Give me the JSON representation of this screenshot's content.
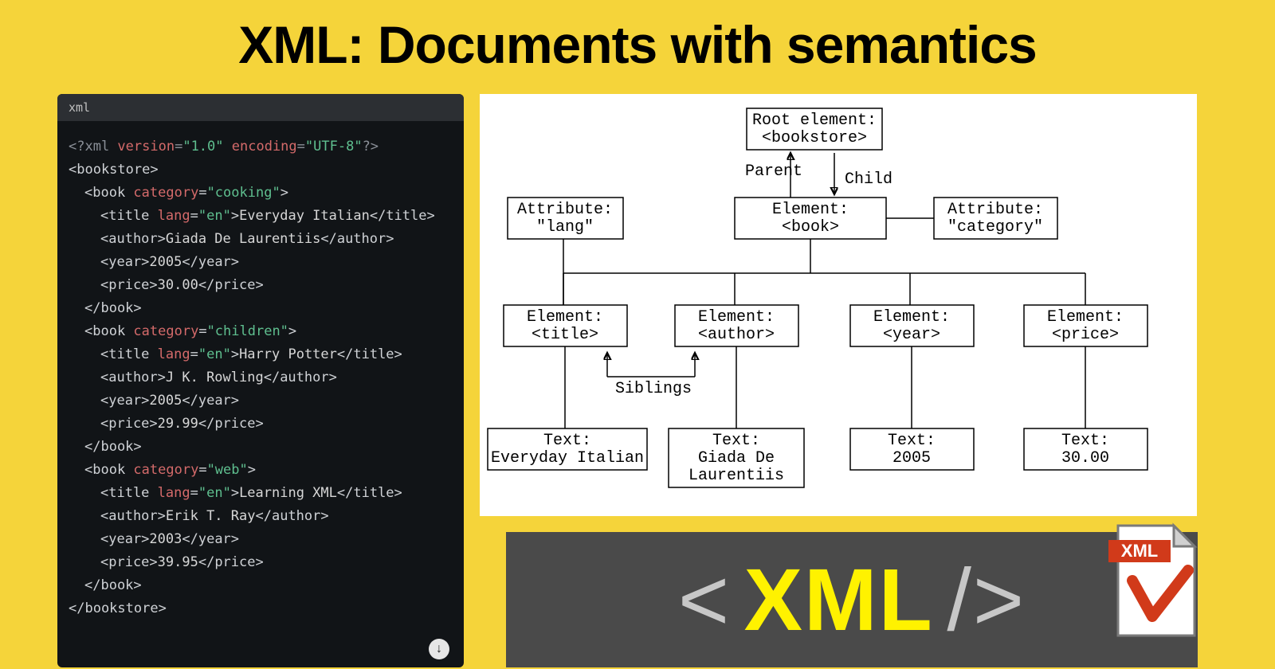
{
  "title": "XML: Documents with semantics",
  "code": {
    "tab": "xml",
    "decl_prefix": "<?xml ",
    "decl_attr1": "version",
    "decl_val1": "\"1.0\"",
    "decl_attr2": "encoding",
    "decl_val2": "\"UTF-8\"",
    "decl_suffix": "?>",
    "root_open": "<bookstore>",
    "root_close": "</bookstore>",
    "book_open_prefix": "<book ",
    "book_attr": "category",
    "book_close_tag": "</book>",
    "title_open_prefix": "<title ",
    "title_attr": "lang",
    "title_attr_val": "\"en\"",
    "title_close": "</title>",
    "author_open": "<author>",
    "author_close": "</author>",
    "year_open": "<year>",
    "year_close": "</year>",
    "price_open": "<price>",
    "price_close": "</price>",
    "books": [
      {
        "category": "\"cooking\"",
        "title": "Everyday Italian",
        "author": "Giada De Laurentiis",
        "year": "2005",
        "price": "30.00"
      },
      {
        "category": "\"children\"",
        "title": "Harry Potter",
        "author": "J K. Rowling",
        "year": "2005",
        "price": "29.99"
      },
      {
        "category": "\"web\"",
        "title": "Learning XML",
        "author": "Erik T. Ray",
        "year": "2003",
        "price": "39.95"
      }
    ]
  },
  "tree": {
    "root_l1": "Root element:",
    "root_l2": "<bookstore>",
    "parent_label": "Parent",
    "child_label": "Child",
    "attr_lang_l1": "Attribute:",
    "attr_lang_l2": "\"lang\"",
    "attr_cat_l1": "Attribute:",
    "attr_cat_l2": "\"category\"",
    "book_l1": "Element:",
    "book_l2": "<book>",
    "title_l1": "Element:",
    "title_l2": "<title>",
    "author_l1": "Element:",
    "author_l2": "<author>",
    "year_l1": "Element:",
    "year_l2": "<year>",
    "price_l1": "Element:",
    "price_l2": "<price>",
    "siblings_label": "Siblings",
    "text_title_l1": "Text:",
    "text_title_l2": "Everyday Italian",
    "text_author_l1": "Text:",
    "text_author_l2": "Giada De",
    "text_author_l3": "Laurentiis",
    "text_year_l1": "Text:",
    "text_year_l2": "2005",
    "text_price_l1": "Text:",
    "text_price_l2": "30.00"
  },
  "banner": {
    "lt": "<",
    "word": "XML",
    "gt": "/>",
    "badge": "XML"
  }
}
